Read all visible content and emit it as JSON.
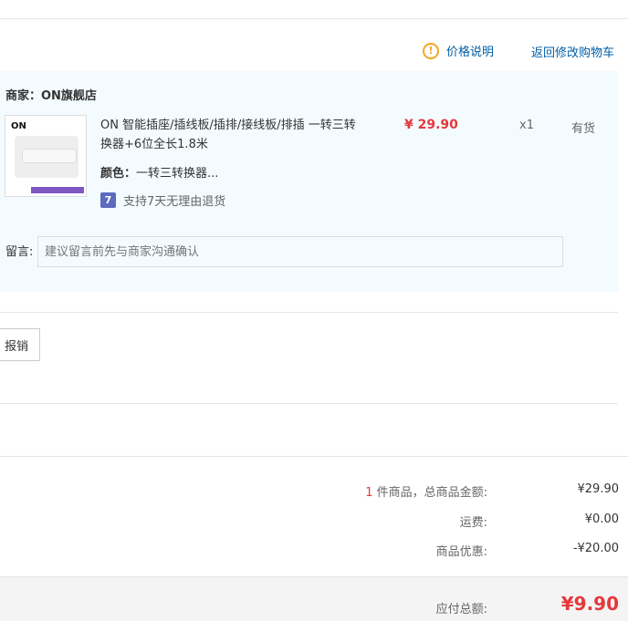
{
  "top": {
    "price_info": "价格说明",
    "back_to_cart": "返回修改购物车"
  },
  "shop": {
    "name": "商家：ON旗舰店",
    "product": {
      "title": "ON 智能插座/插线板/插排/接线板/排插 一转三转换器+6位全长1.8米",
      "color_label": "颜色：",
      "color_value": "一转三转换器...",
      "seven_day": "支持7天无理由退货",
      "seven_icon": "7",
      "price": "¥ 29.90",
      "qty": "x1",
      "stock": "有货",
      "thumb_logo": "ON"
    },
    "message": {
      "label": "留言:",
      "placeholder": "建议留言前先与商家沟通确认"
    }
  },
  "report_button": "报销",
  "summary": {
    "count": "1",
    "goods_label": "件商品，总商品金额:",
    "goods_value": "¥29.90",
    "shipping_label": "运费:",
    "shipping_value": "¥0.00",
    "discount_label": "商品优惠:",
    "discount_value": "-¥20.00",
    "total_label": "应付总额:",
    "total_value": "¥9.90"
  },
  "colors": {
    "accent_red": "#e4393c",
    "link_blue": "#005ea7",
    "shop_bg": "#f3fbfe"
  }
}
